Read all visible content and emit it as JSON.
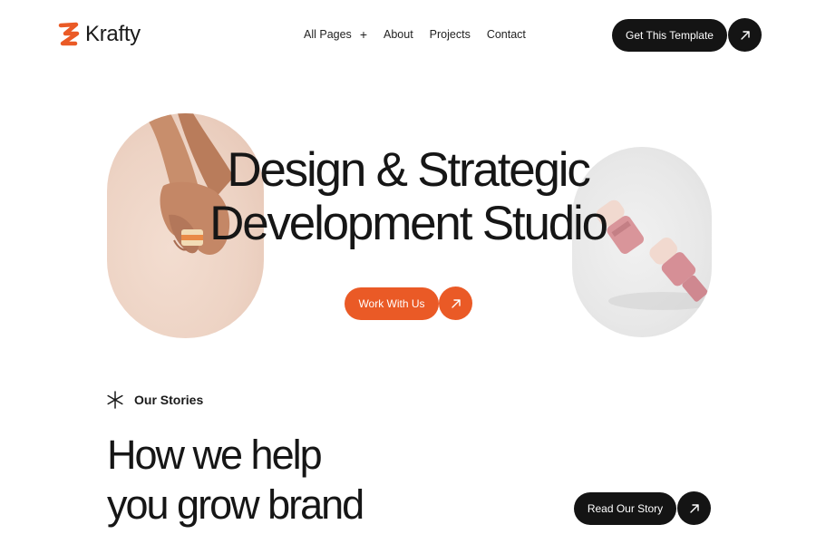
{
  "brand": {
    "name": "Krafty",
    "accent": "#ea5a26",
    "dark": "#141414"
  },
  "nav": {
    "items": [
      {
        "label": "All Pages",
        "icon": "plus-icon"
      },
      {
        "label": "About"
      },
      {
        "label": "Projects"
      },
      {
        "label": "Contact"
      }
    ],
    "cta_label": "Get This Template"
  },
  "hero": {
    "title_line1": "Design & Strategic",
    "title_line2": "Development Studio",
    "button_label": "Work With Us",
    "left_image": "hand-holding-cosmetic-jar",
    "right_image": "pink-dropper-bottles"
  },
  "stories": {
    "label": "Our Stories",
    "heading_line1": "How we help",
    "heading_line2": "you grow brand",
    "button_label": "Read Our Story"
  }
}
